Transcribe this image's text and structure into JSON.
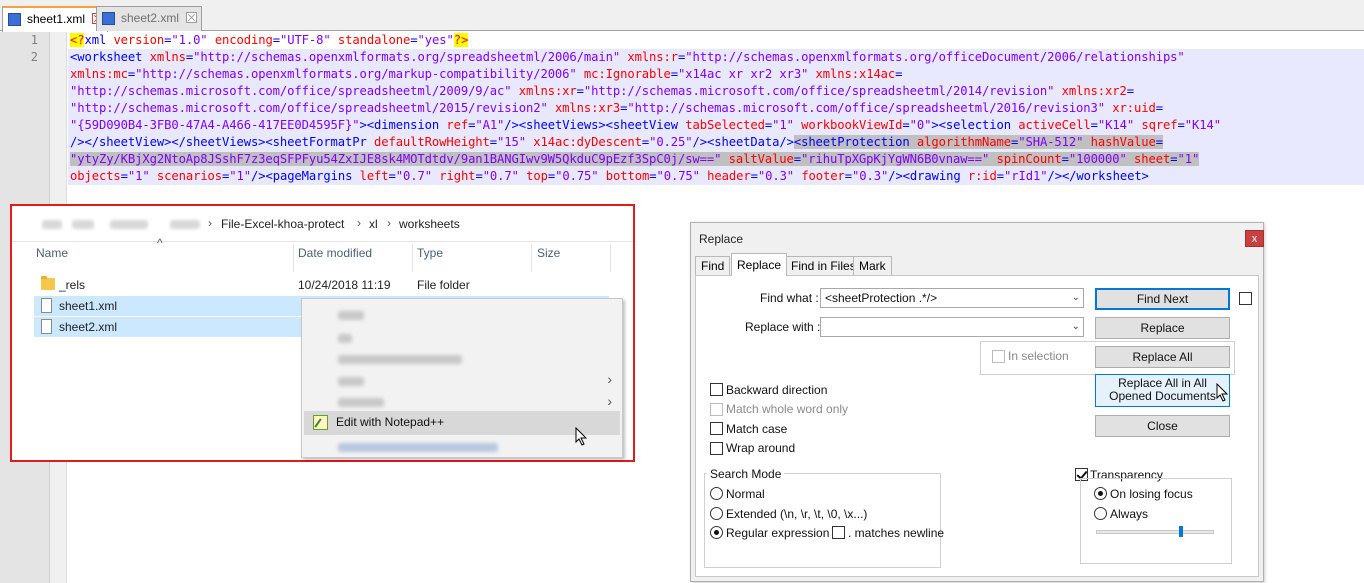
{
  "tabs": [
    {
      "label": "sheet1.xml",
      "active": true
    },
    {
      "label": "sheet2.xml",
      "active": false
    }
  ],
  "editor": {
    "line_numbers": [
      "1",
      "2"
    ],
    "lines": [
      [
        [
          "pi",
          "<?"
        ],
        [
          "tag",
          "xml "
        ],
        [
          "attr",
          "version"
        ],
        [
          "tag",
          "="
        ],
        [
          "val",
          "\"1.0\""
        ],
        [
          "tag",
          " "
        ],
        [
          "attr",
          "encoding"
        ],
        [
          "tag",
          "="
        ],
        [
          "val",
          "\"UTF-8\""
        ],
        [
          "tag",
          " "
        ],
        [
          "attr",
          "standalone"
        ],
        [
          "tag",
          "="
        ],
        [
          "val",
          "\"yes\""
        ],
        [
          "pi",
          "?>"
        ]
      ],
      [
        [
          "tag",
          "<worksheet "
        ],
        [
          "attr",
          "xmlns"
        ],
        [
          "tag",
          "="
        ],
        [
          "val",
          "\"http://schemas.openxmlformats.org/spreadsheetml/2006/main\""
        ],
        [
          "tag",
          " "
        ],
        [
          "attr",
          "xmlns:r"
        ],
        [
          "tag",
          "="
        ],
        [
          "val",
          "\"http://schemas.openxmlformats.org/officeDocument/2006/relationships\""
        ]
      ],
      [
        [
          "attr",
          "xmlns:mc"
        ],
        [
          "tag",
          "="
        ],
        [
          "val",
          "\"http://schemas.openxmlformats.org/markup-compatibility/2006\""
        ],
        [
          "tag",
          " "
        ],
        [
          "attr",
          "mc:Ignorable"
        ],
        [
          "tag",
          "="
        ],
        [
          "val",
          "\"x14ac xr xr2 xr3\""
        ],
        [
          "tag",
          " "
        ],
        [
          "attr",
          "xmlns:x14ac"
        ],
        [
          "tag",
          "="
        ]
      ],
      [
        [
          "val",
          "\"http://schemas.microsoft.com/office/spreadsheetml/2009/9/ac\""
        ],
        [
          "tag",
          " "
        ],
        [
          "attr",
          "xmlns:xr"
        ],
        [
          "tag",
          "="
        ],
        [
          "val",
          "\"http://schemas.microsoft.com/office/spreadsheetml/2014/revision\""
        ],
        [
          "tag",
          " "
        ],
        [
          "attr",
          "xmlns:xr2"
        ],
        [
          "tag",
          "="
        ]
      ],
      [
        [
          "val",
          "\"http://schemas.microsoft.com/office/spreadsheetml/2015/revision2\""
        ],
        [
          "tag",
          " "
        ],
        [
          "attr",
          "xmlns:xr3"
        ],
        [
          "tag",
          "="
        ],
        [
          "val",
          "\"http://schemas.microsoft.com/office/spreadsheetml/2016/revision3\""
        ],
        [
          "tag",
          " "
        ],
        [
          "attr",
          "xr:uid"
        ],
        [
          "tag",
          "="
        ]
      ],
      [
        [
          "val",
          "\"{59D090B4-3FB0-47A4-A466-417EE0D4595F}\""
        ],
        [
          "tag",
          "><dimension "
        ],
        [
          "attr",
          "ref"
        ],
        [
          "tag",
          "="
        ],
        [
          "val",
          "\"A1\""
        ],
        [
          "tag",
          "/><sheetViews><sheetView "
        ],
        [
          "attr",
          "tabSelected"
        ],
        [
          "tag",
          "="
        ],
        [
          "val",
          "\"1\""
        ],
        [
          "tag",
          " "
        ],
        [
          "attr",
          "workbookViewId"
        ],
        [
          "tag",
          "="
        ],
        [
          "val",
          "\"0\""
        ],
        [
          "tag",
          "><selection "
        ],
        [
          "attr",
          "activeCell"
        ],
        [
          "tag",
          "="
        ],
        [
          "val",
          "\"K14\""
        ],
        [
          "tag",
          " "
        ],
        [
          "attr",
          "sqref"
        ],
        [
          "tag",
          "="
        ],
        [
          "val",
          "\"K14\""
        ]
      ],
      [
        [
          "tag",
          "/></sheetView></sheetViews><sheetFormatPr "
        ],
        [
          "attr",
          "defaultRowHeight"
        ],
        [
          "tag",
          "="
        ],
        [
          "val",
          "\"15\""
        ],
        [
          "tag",
          " "
        ],
        [
          "attr",
          "x14ac:dyDescent"
        ],
        [
          "tag",
          "="
        ],
        [
          "val",
          "\"0.25\""
        ],
        [
          "tag",
          "/><sheetData/>"
        ],
        [
          "stag",
          "<sheetProtection "
        ],
        [
          "sattr",
          "algorithmName"
        ],
        [
          "stag",
          "="
        ],
        [
          "sval",
          "\"SHA-512\""
        ],
        [
          "stag",
          " "
        ],
        [
          "sattr",
          "hashValue"
        ],
        [
          "stag",
          "="
        ]
      ],
      [
        [
          "sval",
          "\"ytyZy/KBjXg2NtoAp8JSshF7z3eqSFPFyu54ZxIJE8sk4MOTdtdv/9an1BANGIwv9W5QkduC9pEzf3SpC0j/sw==\""
        ],
        [
          "stag",
          " "
        ],
        [
          "sattr",
          "saltValue"
        ],
        [
          "stag",
          "="
        ],
        [
          "sval",
          "\"rihuTpXGpKjYgWN6B0vnaw==\""
        ],
        [
          "stag",
          " "
        ],
        [
          "sattr",
          "spinCount"
        ],
        [
          "stag",
          "="
        ],
        [
          "sval",
          "\"100000\""
        ],
        [
          "stag",
          " "
        ],
        [
          "sattr",
          "sheet"
        ],
        [
          "stag",
          "="
        ],
        [
          "sval",
          "\"1\""
        ]
      ],
      [
        [
          "attr",
          "objects"
        ],
        [
          "tag",
          "="
        ],
        [
          "val",
          "\"1\""
        ],
        [
          "tag",
          " "
        ],
        [
          "attr",
          "scenarios"
        ],
        [
          "tag",
          "="
        ],
        [
          "val",
          "\"1\""
        ],
        [
          "tag",
          "/><pageMargins "
        ],
        [
          "attr",
          "left"
        ],
        [
          "tag",
          "="
        ],
        [
          "val",
          "\"0.7\""
        ],
        [
          "tag",
          " "
        ],
        [
          "attr",
          "right"
        ],
        [
          "tag",
          "="
        ],
        [
          "val",
          "\"0.7\""
        ],
        [
          "tag",
          " "
        ],
        [
          "attr",
          "top"
        ],
        [
          "tag",
          "="
        ],
        [
          "val",
          "\"0.75\""
        ],
        [
          "tag",
          " "
        ],
        [
          "attr",
          "bottom"
        ],
        [
          "tag",
          "="
        ],
        [
          "val",
          "\"0.75\""
        ],
        [
          "tag",
          " "
        ],
        [
          "attr",
          "header"
        ],
        [
          "tag",
          "="
        ],
        [
          "val",
          "\"0.3\""
        ],
        [
          "tag",
          " "
        ],
        [
          "attr",
          "footer"
        ],
        [
          "tag",
          "="
        ],
        [
          "val",
          "\"0.3\""
        ],
        [
          "tag",
          "/><drawing "
        ],
        [
          "attr",
          "r:id"
        ],
        [
          "tag",
          "="
        ],
        [
          "val",
          "\"rId1\""
        ],
        [
          "tag",
          "/></worksheet>"
        ]
      ]
    ]
  },
  "explorer": {
    "breadcrumb": [
      "File-Excel-khoa-protect",
      "xl",
      "worksheets"
    ],
    "breadcrumb_sep": "›",
    "columns": {
      "name": "Name",
      "date": "Date modified",
      "type": "Type",
      "size": "Size",
      "sort": "^"
    },
    "rows": [
      {
        "name": "_rels",
        "date": "10/24/2018 11:19",
        "type": "File folder",
        "kind": "folder"
      },
      {
        "name": "sheet1.xml",
        "date": "",
        "type": "",
        "kind": "file"
      },
      {
        "name": "sheet2.xml",
        "date": "",
        "type": "",
        "kind": "file"
      }
    ],
    "context_menu": {
      "highlight": "Edit with Notepad++",
      "arrow": "›"
    }
  },
  "dialog": {
    "title": "Replace",
    "close": "x",
    "tabs": [
      "Find",
      "Replace",
      "Find in Files",
      "Mark"
    ],
    "find_what_label": "Find what :",
    "find_what_value": "<sheetProtection .*/>",
    "replace_with_label": "Replace with :",
    "replace_with_value": "",
    "dropdown": "⌄",
    "buttons": {
      "find_next": "Find Next",
      "replace": "Replace",
      "replace_all": "Replace All",
      "replace_all_opened": "Replace All in All Opened Documents",
      "close": "Close"
    },
    "in_selection": "In selection",
    "options": {
      "backward": "Backward direction",
      "whole_word": "Match whole word only",
      "match_case": "Match case",
      "wrap": "Wrap around"
    },
    "search_mode": {
      "title": "Search Mode",
      "normal": "Normal",
      "extended": "Extended (\\n, \\r, \\t, \\0, \\x...)",
      "regex": "Regular expression",
      "matches_newline": ". matches newline",
      "selected": "regex"
    },
    "transparency": {
      "title": "Transparency",
      "checked": true,
      "on_losing_focus": "On losing focus",
      "always": "Always",
      "selected": "on_losing_focus",
      "level": 0.72
    },
    "colors": {
      "accent": "#0078d7",
      "selection": "#cce8ff"
    }
  }
}
